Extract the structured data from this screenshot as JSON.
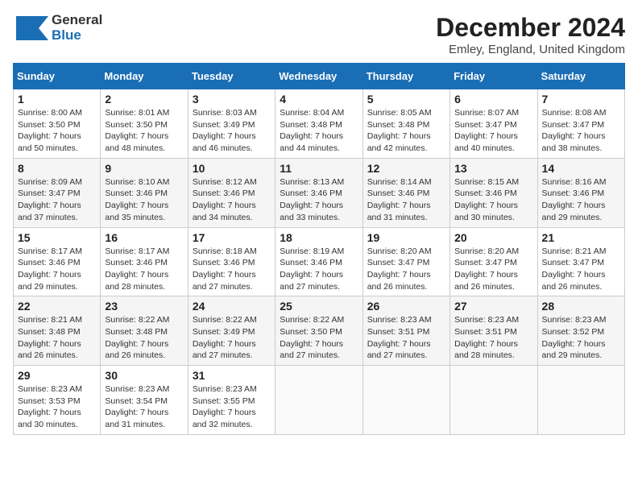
{
  "header": {
    "month_title": "December 2024",
    "location": "Emley, England, United Kingdom",
    "logo_general": "General",
    "logo_blue": "Blue"
  },
  "days_of_week": [
    "Sunday",
    "Monday",
    "Tuesday",
    "Wednesday",
    "Thursday",
    "Friday",
    "Saturday"
  ],
  "weeks": [
    [
      {
        "day": "1",
        "sunrise": "Sunrise: 8:00 AM",
        "sunset": "Sunset: 3:50 PM",
        "daylight": "Daylight: 7 hours and 50 minutes."
      },
      {
        "day": "2",
        "sunrise": "Sunrise: 8:01 AM",
        "sunset": "Sunset: 3:50 PM",
        "daylight": "Daylight: 7 hours and 48 minutes."
      },
      {
        "day": "3",
        "sunrise": "Sunrise: 8:03 AM",
        "sunset": "Sunset: 3:49 PM",
        "daylight": "Daylight: 7 hours and 46 minutes."
      },
      {
        "day": "4",
        "sunrise": "Sunrise: 8:04 AM",
        "sunset": "Sunset: 3:48 PM",
        "daylight": "Daylight: 7 hours and 44 minutes."
      },
      {
        "day": "5",
        "sunrise": "Sunrise: 8:05 AM",
        "sunset": "Sunset: 3:48 PM",
        "daylight": "Daylight: 7 hours and 42 minutes."
      },
      {
        "day": "6",
        "sunrise": "Sunrise: 8:07 AM",
        "sunset": "Sunset: 3:47 PM",
        "daylight": "Daylight: 7 hours and 40 minutes."
      },
      {
        "day": "7",
        "sunrise": "Sunrise: 8:08 AM",
        "sunset": "Sunset: 3:47 PM",
        "daylight": "Daylight: 7 hours and 38 minutes."
      }
    ],
    [
      {
        "day": "8",
        "sunrise": "Sunrise: 8:09 AM",
        "sunset": "Sunset: 3:47 PM",
        "daylight": "Daylight: 7 hours and 37 minutes."
      },
      {
        "day": "9",
        "sunrise": "Sunrise: 8:10 AM",
        "sunset": "Sunset: 3:46 PM",
        "daylight": "Daylight: 7 hours and 35 minutes."
      },
      {
        "day": "10",
        "sunrise": "Sunrise: 8:12 AM",
        "sunset": "Sunset: 3:46 PM",
        "daylight": "Daylight: 7 hours and 34 minutes."
      },
      {
        "day": "11",
        "sunrise": "Sunrise: 8:13 AM",
        "sunset": "Sunset: 3:46 PM",
        "daylight": "Daylight: 7 hours and 33 minutes."
      },
      {
        "day": "12",
        "sunrise": "Sunrise: 8:14 AM",
        "sunset": "Sunset: 3:46 PM",
        "daylight": "Daylight: 7 hours and 31 minutes."
      },
      {
        "day": "13",
        "sunrise": "Sunrise: 8:15 AM",
        "sunset": "Sunset: 3:46 PM",
        "daylight": "Daylight: 7 hours and 30 minutes."
      },
      {
        "day": "14",
        "sunrise": "Sunrise: 8:16 AM",
        "sunset": "Sunset: 3:46 PM",
        "daylight": "Daylight: 7 hours and 29 minutes."
      }
    ],
    [
      {
        "day": "15",
        "sunrise": "Sunrise: 8:17 AM",
        "sunset": "Sunset: 3:46 PM",
        "daylight": "Daylight: 7 hours and 29 minutes."
      },
      {
        "day": "16",
        "sunrise": "Sunrise: 8:17 AM",
        "sunset": "Sunset: 3:46 PM",
        "daylight": "Daylight: 7 hours and 28 minutes."
      },
      {
        "day": "17",
        "sunrise": "Sunrise: 8:18 AM",
        "sunset": "Sunset: 3:46 PM",
        "daylight": "Daylight: 7 hours and 27 minutes."
      },
      {
        "day": "18",
        "sunrise": "Sunrise: 8:19 AM",
        "sunset": "Sunset: 3:46 PM",
        "daylight": "Daylight: 7 hours and 27 minutes."
      },
      {
        "day": "19",
        "sunrise": "Sunrise: 8:20 AM",
        "sunset": "Sunset: 3:47 PM",
        "daylight": "Daylight: 7 hours and 26 minutes."
      },
      {
        "day": "20",
        "sunrise": "Sunrise: 8:20 AM",
        "sunset": "Sunset: 3:47 PM",
        "daylight": "Daylight: 7 hours and 26 minutes."
      },
      {
        "day": "21",
        "sunrise": "Sunrise: 8:21 AM",
        "sunset": "Sunset: 3:47 PM",
        "daylight": "Daylight: 7 hours and 26 minutes."
      }
    ],
    [
      {
        "day": "22",
        "sunrise": "Sunrise: 8:21 AM",
        "sunset": "Sunset: 3:48 PM",
        "daylight": "Daylight: 7 hours and 26 minutes."
      },
      {
        "day": "23",
        "sunrise": "Sunrise: 8:22 AM",
        "sunset": "Sunset: 3:48 PM",
        "daylight": "Daylight: 7 hours and 26 minutes."
      },
      {
        "day": "24",
        "sunrise": "Sunrise: 8:22 AM",
        "sunset": "Sunset: 3:49 PM",
        "daylight": "Daylight: 7 hours and 27 minutes."
      },
      {
        "day": "25",
        "sunrise": "Sunrise: 8:22 AM",
        "sunset": "Sunset: 3:50 PM",
        "daylight": "Daylight: 7 hours and 27 minutes."
      },
      {
        "day": "26",
        "sunrise": "Sunrise: 8:23 AM",
        "sunset": "Sunset: 3:51 PM",
        "daylight": "Daylight: 7 hours and 27 minutes."
      },
      {
        "day": "27",
        "sunrise": "Sunrise: 8:23 AM",
        "sunset": "Sunset: 3:51 PM",
        "daylight": "Daylight: 7 hours and 28 minutes."
      },
      {
        "day": "28",
        "sunrise": "Sunrise: 8:23 AM",
        "sunset": "Sunset: 3:52 PM",
        "daylight": "Daylight: 7 hours and 29 minutes."
      }
    ],
    [
      {
        "day": "29",
        "sunrise": "Sunrise: 8:23 AM",
        "sunset": "Sunset: 3:53 PM",
        "daylight": "Daylight: 7 hours and 30 minutes."
      },
      {
        "day": "30",
        "sunrise": "Sunrise: 8:23 AM",
        "sunset": "Sunset: 3:54 PM",
        "daylight": "Daylight: 7 hours and 31 minutes."
      },
      {
        "day": "31",
        "sunrise": "Sunrise: 8:23 AM",
        "sunset": "Sunset: 3:55 PM",
        "daylight": "Daylight: 7 hours and 32 minutes."
      },
      null,
      null,
      null,
      null
    ]
  ]
}
